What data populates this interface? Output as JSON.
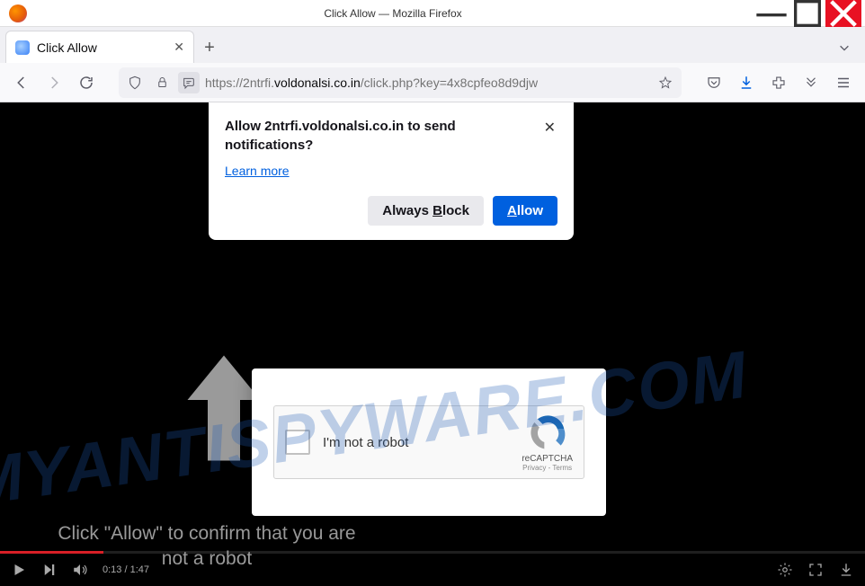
{
  "window": {
    "title": "Click Allow — Mozilla Firefox"
  },
  "tab": {
    "title": "Click Allow"
  },
  "url": {
    "protocol": "https://",
    "sub": "2ntrfi.",
    "domain": "voldonalsi.co.in",
    "path": "/click.php?key=4x8cpfeo8d9djw"
  },
  "notification": {
    "title": "Allow 2ntrfi.voldonalsi.co.in to send notifications?",
    "learn_more": "Learn more",
    "block_pre": "Always ",
    "block_u": "B",
    "block_post": "lock",
    "allow_u": "A",
    "allow_post": "llow"
  },
  "captcha": {
    "label": "I'm not a robot",
    "brand": "reCAPTCHA",
    "links": "Privacy - Terms"
  },
  "instruction": {
    "text": "Click \"Allow\" to confirm that you are not a robot"
  },
  "video": {
    "time": "0:13 / 1:47"
  },
  "watermark": {
    "text": "MYANTISPYWARE.COM"
  }
}
